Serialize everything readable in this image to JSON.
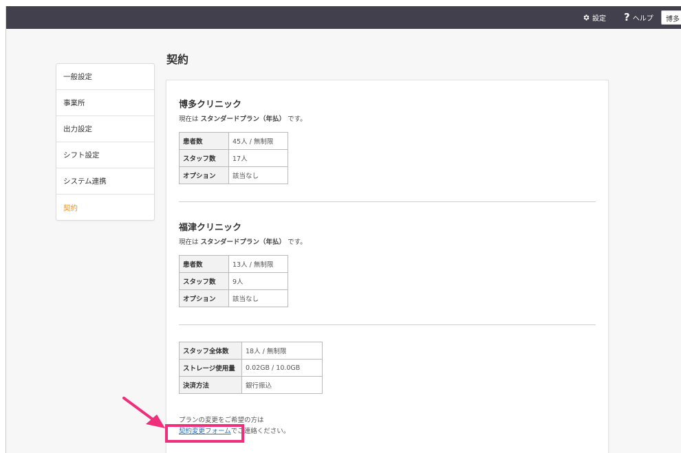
{
  "header": {
    "settings_label": "設定",
    "help_icon": "?",
    "help_label": "ヘルプ",
    "user_label": "博多",
    "bg_color": "#41404c"
  },
  "page": {
    "title": "契約"
  },
  "sidebar": {
    "items": [
      {
        "label": "一般設定",
        "active": false
      },
      {
        "label": "事業所",
        "active": false
      },
      {
        "label": "出力設定",
        "active": false
      },
      {
        "label": "シフト設定",
        "active": false
      },
      {
        "label": "システム連携",
        "active": false
      },
      {
        "label": "契約",
        "active": true
      }
    ],
    "active_color": "#e8952b"
  },
  "clinics": [
    {
      "name": "博多クリニック",
      "plan_prefix": "現在は",
      "plan_name": "スタンダードプラン（年払）",
      "plan_suffix": "です。",
      "rows": [
        {
          "key": "患者数",
          "value": "45人 / 無制限"
        },
        {
          "key": "スタッフ数",
          "value": "17人"
        },
        {
          "key": "オプション",
          "value": "該当なし"
        }
      ]
    },
    {
      "name": "福津クリニック",
      "plan_prefix": "現在は",
      "plan_name": "スタンダードプラン（年払）",
      "plan_suffix": "です。",
      "rows": [
        {
          "key": "患者数",
          "value": "13人 / 無制限"
        },
        {
          "key": "スタッフ数",
          "value": "9人"
        },
        {
          "key": "オプション",
          "value": "該当なし"
        }
      ]
    }
  ],
  "summary": {
    "rows": [
      {
        "key": "スタッフ全体数",
        "value": "18人 / 無制限"
      },
      {
        "key": "ストレージ使用量",
        "value": "0.02GB / 10.0GB"
      },
      {
        "key": "決済方法",
        "value": "銀行振込"
      }
    ]
  },
  "note": {
    "line1": "プランの変更をご希望の方は",
    "link_text": "契約変更フォーム",
    "line2_suffix": "でご連絡ください。"
  },
  "annotation": {
    "color": "#ee2f7c"
  }
}
